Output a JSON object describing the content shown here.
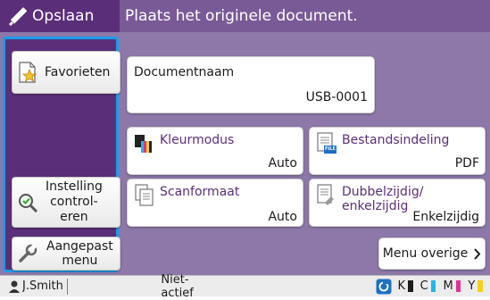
{
  "header": {
    "mode_label": "Opslaan",
    "message": "Plaats het originele document."
  },
  "sidebar": {
    "favorites_label": "Favorieten",
    "check_settings_label_lines": [
      "Instelling",
      "control-",
      "eren"
    ],
    "custom_menu_label_lines": [
      "Aangepast",
      "menu"
    ]
  },
  "document": {
    "label": "Documentnaam",
    "value": "USB-0001"
  },
  "settings": [
    {
      "label": "Kleurmodus",
      "value": "Auto",
      "icon": "color-mode-icon"
    },
    {
      "label": "Bestandsindeling",
      "value": "PDF",
      "icon": "file-format-icon",
      "badge": "FILE"
    },
    {
      "label": "Scanformaat",
      "value": "Auto",
      "icon": "scan-size-icon"
    },
    {
      "label_lines": [
        "Dubbelzijdig/",
        "enkelzijdig"
      ],
      "value": "Enkelzijdig",
      "icon": "duplex-icon"
    }
  ],
  "other_menu": {
    "label": "Menu overige"
  },
  "status": {
    "user": "J.Smith",
    "state": "Niet-actief",
    "toner": [
      {
        "label": "K",
        "color": "#1b1b1b"
      },
      {
        "label": "C",
        "color": "#1fb7ea"
      },
      {
        "label": "M",
        "color": "#e2318f"
      },
      {
        "label": "Y",
        "color": "#f2d21b"
      }
    ]
  },
  "colors": {
    "header_dark": "#5b2e7a",
    "header_light": "#7a5a96",
    "main_bg": "#8d78a9",
    "focus": "#1e9be6"
  }
}
